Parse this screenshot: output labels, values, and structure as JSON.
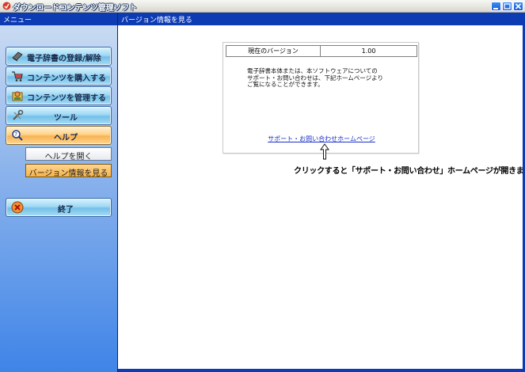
{
  "window": {
    "title": "ダウンロードコンテンツ管理ソフト"
  },
  "left_panel": {
    "header": "メニュー",
    "nav": [
      {
        "label": "電子辞書の登録/解除",
        "icon": "dictionary-icon"
      },
      {
        "label": "コンテンツを購入する",
        "icon": "shopping-cart-icon"
      },
      {
        "label": "コンテンツを管理する",
        "icon": "manage-icon"
      },
      {
        "label": "ツール",
        "icon": "tools-icon"
      },
      {
        "label": "ヘルプ",
        "icon": "help-magnifier-icon"
      }
    ],
    "help_sub": [
      {
        "label": "ヘルプを開く"
      },
      {
        "label": "バージョン情報を見る"
      }
    ],
    "exit": {
      "label": "終了",
      "icon": "exit-icon"
    }
  },
  "main": {
    "header": "バージョン情報を見る",
    "version_label": "現在のバージョン",
    "version_value": "1.00",
    "info_line1": "電子辞書本体または、本ソフトウェアについての",
    "info_line2": "サポート・お問い合わせは、下記ホームページより",
    "info_line3": "ご覧になることができます。",
    "support_link": "サポート・お問い合わせホームページ",
    "caption": "クリックすると「サポート・お問い合わせ」ホームページが開きます"
  },
  "colors": {
    "header_blue": "#0c3bb4",
    "nav_button": "#9fd8f5",
    "nav_active": "#f8b452",
    "link": "#1a30c8"
  }
}
